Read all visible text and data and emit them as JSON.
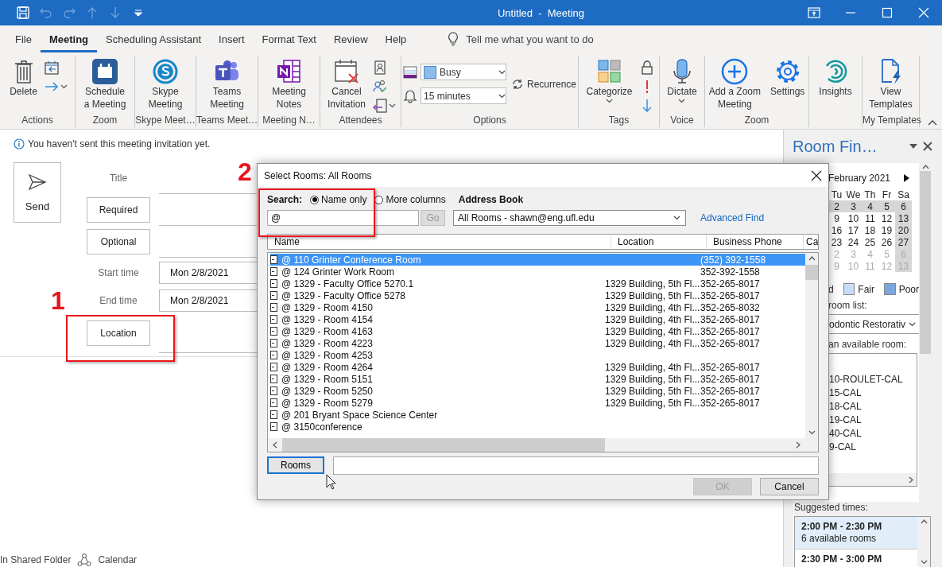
{
  "window": {
    "title": "Untitled  -  Meeting"
  },
  "quick_access": [
    {
      "disabled": false
    },
    {
      "disabled": true
    },
    {
      "disabled": true
    },
    {
      "disabled": true
    },
    {
      "disabled": true
    },
    {
      "disabled": false
    }
  ],
  "menu_tabs": [
    {
      "label": "File",
      "selected": false
    },
    {
      "label": "Meeting",
      "selected": true
    },
    {
      "label": "Scheduling Assistant",
      "selected": false
    },
    {
      "label": "Insert",
      "selected": false
    },
    {
      "label": "Format Text",
      "selected": false
    },
    {
      "label": "Review",
      "selected": false
    },
    {
      "label": "Help",
      "selected": false
    }
  ],
  "tell_me": {
    "placeholder": "Tell me what you want to do"
  },
  "ribbon": {
    "groups": [
      {
        "label": "Actions",
        "items": [
          {
            "kind": "large",
            "label": "Delete"
          },
          {
            "kind": "icons"
          }
        ]
      },
      {
        "label": "Zoom",
        "items": [
          {
            "kind": "large",
            "label": "Schedule\na Meeting"
          }
        ]
      },
      {
        "label": "Skype Meet…",
        "items": [
          {
            "kind": "large",
            "label": "Skype\nMeeting"
          }
        ]
      },
      {
        "label": "Teams Meet…",
        "items": [
          {
            "kind": "large",
            "label": "Teams\nMeeting"
          }
        ]
      },
      {
        "label": "Meeting N…",
        "items": [
          {
            "kind": "large",
            "label": "Meeting\nNotes"
          }
        ]
      },
      {
        "label": "Attendees",
        "items": [
          {
            "kind": "large",
            "label": "Cancel\nInvitation"
          },
          {
            "kind": "icons"
          }
        ]
      },
      {
        "label": "Options",
        "items": [
          {
            "kind": "combos",
            "combos": [
              {
                "value": "Busy"
              },
              {
                "value": "15 minutes"
              }
            ]
          },
          {
            "kind": "small",
            "label": "Recurrence"
          }
        ]
      },
      {
        "label": "Tags",
        "items": [
          {
            "kind": "large",
            "label": "Categorize",
            "caret": true
          },
          {
            "kind": "icons"
          }
        ]
      },
      {
        "label": "Voice",
        "items": [
          {
            "kind": "large",
            "label": "Dictate",
            "caret": true
          }
        ]
      },
      {
        "label": "Zoom",
        "items": [
          {
            "kind": "large",
            "label": "Add a Zoom\nMeeting"
          },
          {
            "kind": "large",
            "label": "Settings"
          }
        ]
      },
      {
        "items": [
          {
            "kind": "large",
            "label": "Insights"
          }
        ]
      },
      {
        "label": "My Templates",
        "items": [
          {
            "kind": "large",
            "label": "View\nTemplates"
          }
        ]
      }
    ]
  },
  "info_bar": {
    "text": "You haven't sent this meeting invitation yet."
  },
  "send_button": {
    "label": "Send"
  },
  "fields": [
    {
      "kind": "label",
      "label": "Title"
    },
    {
      "kind": "button",
      "label": "Required"
    },
    {
      "kind": "button",
      "label": "Optional"
    },
    {
      "kind": "date",
      "label": "Start time",
      "value": "Mon 2/8/2021"
    },
    {
      "kind": "date",
      "label": "End time",
      "value": "Mon 2/8/2021"
    },
    {
      "kind": "button",
      "label": "Location"
    }
  ],
  "status_bar": {
    "items": [
      "In Shared Folder",
      "Calendar"
    ]
  },
  "room_finder": {
    "title": "Room Fin…",
    "month": "February 2021",
    "weekdays": [
      "Tu",
      "We",
      "Th",
      "Fr",
      "Sa"
    ],
    "weeks": [
      [
        {
          "day": "2",
          "shaded": true,
          "faded": false
        },
        {
          "day": "3",
          "shaded": true,
          "faded": false
        },
        {
          "day": "4",
          "shaded": true,
          "faded": false
        },
        {
          "day": "5",
          "shaded": true,
          "faded": false
        },
        {
          "day": "6",
          "shaded": true,
          "faded": false
        }
      ],
      [
        {
          "day": "9",
          "shaded": false,
          "faded": false
        },
        {
          "day": "10",
          "shaded": false,
          "faded": false
        },
        {
          "day": "11",
          "shaded": false,
          "faded": false
        },
        {
          "day": "12",
          "shaded": false,
          "faded": false
        },
        {
          "day": "13",
          "shaded": true,
          "faded": false
        }
      ],
      [
        {
          "day": "16",
          "shaded": false,
          "faded": false
        },
        {
          "day": "17",
          "shaded": false,
          "faded": false
        },
        {
          "day": "18",
          "shaded": false,
          "faded": false
        },
        {
          "day": "19",
          "shaded": false,
          "faded": false
        },
        {
          "day": "20",
          "shaded": true,
          "faded": false
        }
      ],
      [
        {
          "day": "23",
          "shaded": false,
          "faded": false
        },
        {
          "day": "24",
          "shaded": false,
          "faded": false
        },
        {
          "day": "25",
          "shaded": false,
          "faded": false
        },
        {
          "day": "26",
          "shaded": false,
          "faded": false
        },
        {
          "day": "27",
          "shaded": true,
          "faded": false
        }
      ],
      [
        {
          "day": "2",
          "shaded": false,
          "faded": true
        },
        {
          "day": "3",
          "shaded": false,
          "faded": true
        },
        {
          "day": "4",
          "shaded": false,
          "faded": true
        },
        {
          "day": "5",
          "shaded": false,
          "faded": true
        },
        {
          "day": "6",
          "shaded": true,
          "faded": true
        }
      ],
      [
        {
          "day": "9",
          "shaded": false,
          "faded": true
        },
        {
          "day": "10",
          "shaded": false,
          "faded": true
        },
        {
          "day": "11",
          "shaded": false,
          "faded": true
        },
        {
          "day": "12",
          "shaded": false,
          "faded": true
        },
        {
          "day": "13",
          "shaded": true,
          "faded": true
        }
      ]
    ],
    "legend": [
      {
        "label": "d"
      },
      {
        "label": "Fair",
        "color": "#c6ddf8"
      },
      {
        "label": "Poor",
        "color": "#7ba6de"
      }
    ],
    "room_list_label": "room list:",
    "room_list_value": "odontic Restorativ",
    "rooms_label": "an available room:",
    "rooms": [
      "10-ROULET-CAL",
      "15-CAL",
      "18-CAL",
      "19-CAL",
      "40-CAL",
      "9-CAL"
    ],
    "suggested_label": "Suggested times:",
    "suggested": [
      {
        "time": "2:00 PM - 2:30 PM",
        "detail": "6 available rooms",
        "selected": true
      },
      {
        "time": "2:30 PM - 3:00 PM",
        "selected": false
      }
    ]
  },
  "dialog": {
    "title": "Select Rooms: All Rooms",
    "search_label": "Search:",
    "search_options": [
      {
        "label": "Name only",
        "selected": true
      },
      {
        "label": "More columns",
        "selected": false
      }
    ],
    "search_value": "@",
    "go_button": {
      "label": "Go",
      "disabled": true
    },
    "address_book_label": "Address Book",
    "address_book_value": "All Rooms - shawn@eng.ufl.edu",
    "advanced_find": "Advanced Find",
    "columns": [
      "Name",
      "Location",
      "Business Phone",
      "Ca"
    ],
    "rows": [
      {
        "name": "@ 110 Grinter Conference Room",
        "phone": "(352) 392-1558",
        "selected": true
      },
      {
        "name": "@ 124 Grinter Work Room",
        "phone": "352-392-1558",
        "selected": false
      },
      {
        "name": "@ 1329 - Faculty Office 5270.1",
        "location": "1329 Building, 5th Fl...",
        "phone": "352-265-8017",
        "selected": false
      },
      {
        "name": "@ 1329 - Faculty Office 5278",
        "location": "1329 Building, 5th Fl...",
        "phone": "352-265-8017",
        "selected": false
      },
      {
        "name": "@ 1329 - Room 4150",
        "location": "1329 Building, 4th Fl...",
        "phone": "352-265-8032",
        "selected": false
      },
      {
        "name": "@ 1329 - Room 4154",
        "location": "1329 Building, 4th Fl...",
        "phone": "352-265-8017",
        "selected": false
      },
      {
        "name": "@ 1329 - Room 4163",
        "location": "1329 Building, 4th Fl...",
        "phone": "352-265-8017",
        "selected": false
      },
      {
        "name": "@ 1329 - Room 4223",
        "location": "1329 Building, 4th Fl...",
        "phone": "352-265-8017",
        "selected": false
      },
      {
        "name": "@ 1329 - Room 4253",
        "selected": false
      },
      {
        "name": "@ 1329 - Room 4264",
        "location": "1329 Building, 4th Fl...",
        "phone": "352-265-8017",
        "selected": false
      },
      {
        "name": "@ 1329 - Room 5151",
        "location": "1329 Building, 5th Fl...",
        "phone": "352-265-8017",
        "selected": false
      },
      {
        "name": "@ 1329 - Room 5250",
        "location": "1329 Building, 5th Fl...",
        "phone": "352-265-8017",
        "selected": false
      },
      {
        "name": "@ 1329 - Room 5279",
        "location": "1329 Building, 5th Fl...",
        "phone": "352-265-8017",
        "selected": false
      },
      {
        "name": "@ 201 Bryant Space Science Center",
        "selected": false
      },
      {
        "name": "@ 3150conference",
        "selected": false
      }
    ],
    "rooms_button": "Rooms",
    "ok_button": {
      "label": "OK",
      "disabled": true
    },
    "cancel_button": {
      "label": "Cancel",
      "disabled": false
    }
  },
  "annotations": [
    "1",
    "2"
  ]
}
